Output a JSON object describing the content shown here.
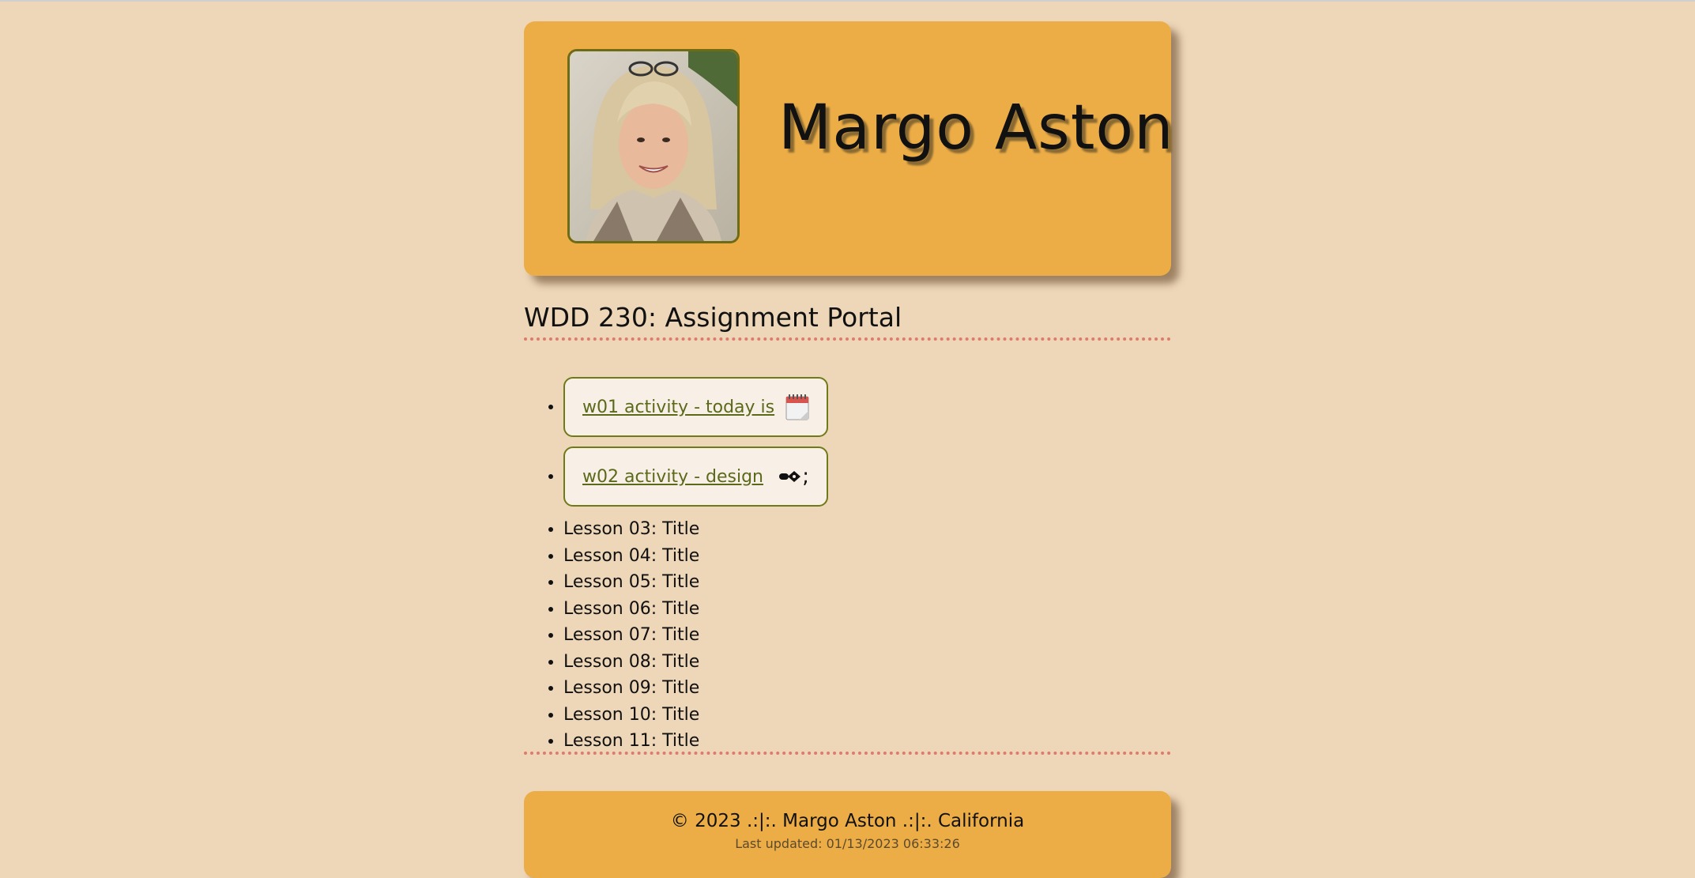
{
  "header": {
    "name": "Margo Aston",
    "photo_alt": "Margo Aston"
  },
  "main": {
    "title": "WDD 230: Assignment Portal",
    "activities": [
      {
        "label": "w01 activity - today is ",
        "icon": "calendar-icon",
        "icon_suffix": ""
      },
      {
        "label": "w02 activity - design",
        "icon": "pen-nib-icon",
        "icon_suffix": ";"
      }
    ],
    "lessons": [
      "Lesson 03: Title",
      "Lesson 04: Title",
      "Lesson 05: Title",
      "Lesson 06: Title",
      "Lesson 07: Title",
      "Lesson 08: Title",
      "Lesson 09: Title",
      "Lesson 10: Title",
      "Lesson 11: Title"
    ]
  },
  "footer": {
    "copyright": "© 2023 .:|:. Margo Aston .:|:. California",
    "last_updated": "Last updated: 01/13/2023 06:33:26"
  },
  "colors": {
    "background": "#eed6b8",
    "header_bg": "#ecad47",
    "card_bg": "#f8efe6",
    "link": "#5a6a1a",
    "divider": "#e07a6a"
  }
}
